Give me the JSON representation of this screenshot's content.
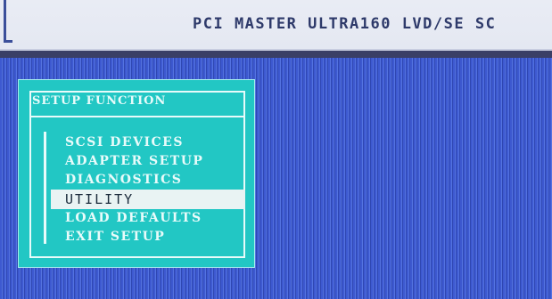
{
  "header": {
    "title": "PCI MASTER ULTRA160 LVD/SE SC"
  },
  "setup_window": {
    "title": "SETUP FUNCTION",
    "items": [
      {
        "label": "SCSI DEVICES",
        "selected": false
      },
      {
        "label": "ADAPTER SETUP",
        "selected": false
      },
      {
        "label": "DIAGNOSTICS",
        "selected": false
      },
      {
        "label": "UTILITY",
        "selected": true
      },
      {
        "label": "LOAD DEFAULTS",
        "selected": false
      },
      {
        "label": "EXIT SETUP",
        "selected": false
      }
    ]
  },
  "colors": {
    "desktop": "#3b55c9",
    "window": "#22c7c4",
    "highlight": "#e9f3f3",
    "title_bar": "#e9ecf4"
  }
}
